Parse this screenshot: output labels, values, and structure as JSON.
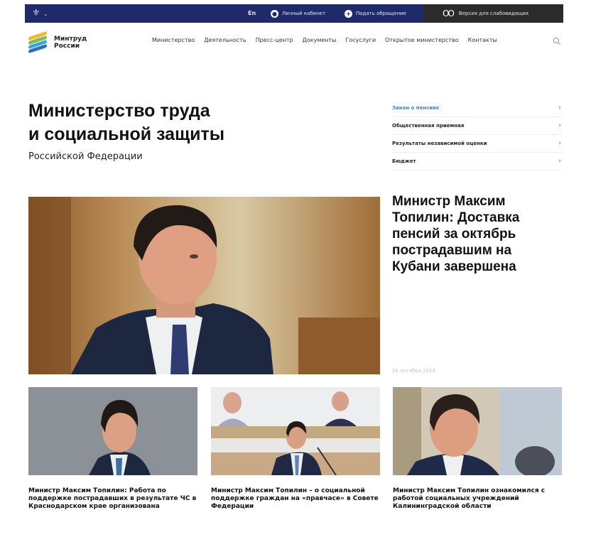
{
  "topbar": {
    "lang": "En",
    "account_label": "Личный кабинет",
    "appeal_label": "Подать обращение",
    "accessibility_label": "Версия для слабовидящих"
  },
  "header": {
    "logo_line1": "Минтруд",
    "logo_line2": "России",
    "nav": [
      "Министерство",
      "Деятельность",
      "Пресс-центр",
      "Документы",
      "Госуслуги",
      "Открытое министерство",
      "Контакты"
    ]
  },
  "title_block": {
    "title_line1": "Министерство труда",
    "title_line2": "и социальной защиты",
    "subtitle": "Российской Федерации"
  },
  "quick_links": [
    {
      "label": "Закон о пенсиях",
      "active": true
    },
    {
      "label": "Общественная приемная",
      "active": false
    },
    {
      "label": "Результаты независимой оценки",
      "active": false
    },
    {
      "label": "Бюджет",
      "active": false
    }
  ],
  "hero": {
    "title": "Министр Максим Топилин: Доставка пенсий за октябрь пострадавшим на Кубани завершена",
    "date": "26 октября 2018"
  },
  "cards": [
    {
      "title": "Министр Максим Топилин: Работа по поддержке пострадавших в результате ЧС в Краснодарском крае организована"
    },
    {
      "title": "Министр Максим Топилин – о социальной поддержке граждан на «правчасе» в Совете Федерации"
    },
    {
      "title": "Министр Максим Топилин ознакомился с работой социальных учреждений Калининградской области"
    }
  ],
  "colors": {
    "topbar": "#1f2a6b",
    "accessibility_bg": "#2b2b2b",
    "active_link": "#3b7fd9"
  }
}
